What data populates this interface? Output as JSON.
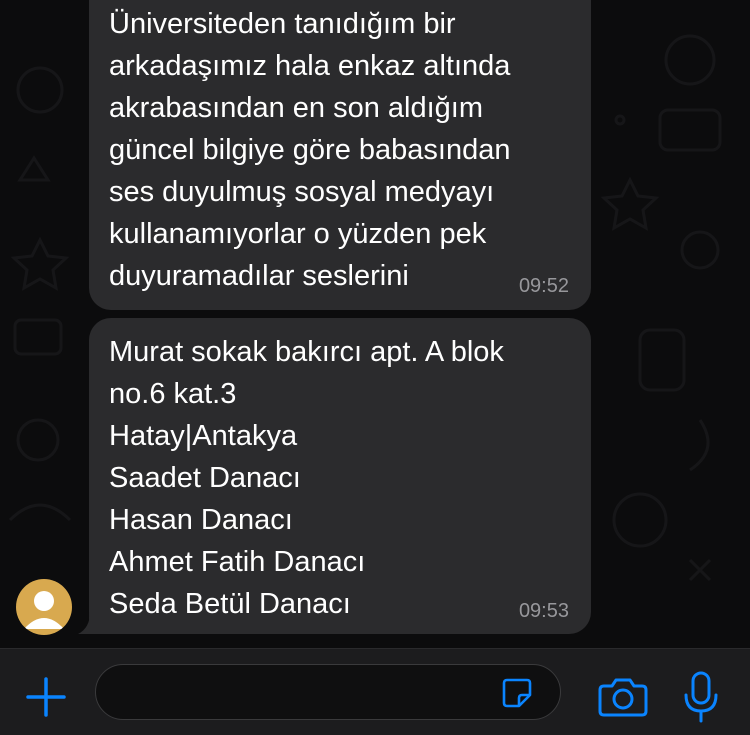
{
  "messages": [
    {
      "lines": [
        "Üniversiteden tanıdığım bir",
        "arkadaşımız hala enkaz altında",
        "akrabasından en son aldığım",
        "güncel bilgiye göre babasından",
        "ses duyulmuş sosyal medyayı",
        "kullanamıyorlar o yüzden pek",
        "duyuramadılar seslerini"
      ],
      "time": "09:52"
    },
    {
      "lines": [
        "Murat sokak bakırcı apt. A blok",
        "no.6 kat.3",
        "Hatay|Antakya",
        "Saadet Danacı",
        "Hasan Danacı",
        "Ahmet Fatih Danacı",
        "Seda Betül Danacı"
      ],
      "time": "09:53"
    }
  ],
  "input": {
    "value": "",
    "placeholder": ""
  },
  "icons": {
    "add": "plus-icon",
    "sticker": "sticker-icon",
    "camera": "camera-icon",
    "mic": "microphone-icon",
    "avatar": "user-avatar"
  },
  "colors": {
    "accent": "#0a84ff",
    "bubble": "#2b2b2d",
    "avatar": "#d8a94f",
    "timestamp": "#97979b"
  }
}
